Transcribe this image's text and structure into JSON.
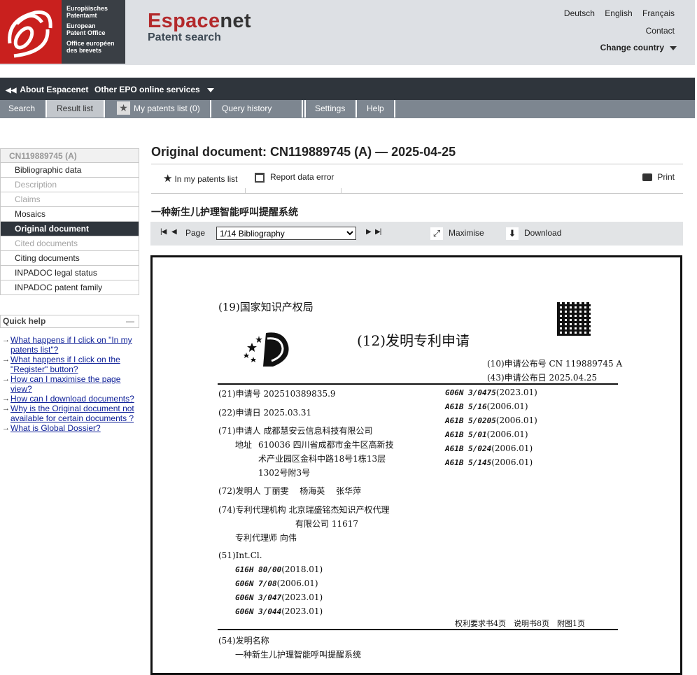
{
  "logo": {
    "lines": [
      "Europäisches",
      "Patentamt",
      "European",
      "Patent Office",
      "Office européen",
      "des brevets"
    ]
  },
  "brand": {
    "title_red": "Espace",
    "title_dark": "net",
    "subtitle": "Patent search"
  },
  "header_links": {
    "languages": [
      "Deutsch",
      "English",
      "Français"
    ],
    "contact": "Contact",
    "change_country": "Change country"
  },
  "topnav": {
    "about": "About Espacenet",
    "other": "Other EPO online services"
  },
  "tabs": [
    {
      "label": "Search"
    },
    {
      "label": "Result list"
    },
    {
      "label": "My patents list (0)"
    },
    {
      "label": "Query history"
    },
    {
      "label": ""
    },
    {
      "label": "Settings"
    },
    {
      "label": "Help"
    }
  ],
  "sidebar": {
    "items": [
      "CN119889745 (A)",
      "Bibliographic data",
      "Description",
      "Claims",
      "Mosaics",
      "Original document",
      "Cited documents",
      "Citing documents",
      "INPADOC legal status",
      "INPADOC patent family"
    ]
  },
  "quick_help": {
    "title": "Quick help",
    "links": [
      "What happens if I click on \"In my patents list\"?",
      "What happens if I click on the \"Register\" button?",
      "How can I maximise the page view?",
      "How can I download documents?",
      "Why is the Original document not available for certain documents ?",
      "What is Global Dossier?"
    ]
  },
  "main": {
    "title": "Original document: CN119889745 (A) — 2025-04-25",
    "actions": {
      "in_list": "In my patents list",
      "report": "Report data error",
      "print": "Print"
    },
    "doc_title_cn": "一种新生儿护理智能呼叫提醒系统",
    "viewer": {
      "page_label": "Page",
      "page_value": "1/14 Bibliography",
      "maximise": "Maximise",
      "download": "Download"
    }
  },
  "document": {
    "office": "(19)国家知识产权局",
    "kind": "(12)发明专利申请",
    "pub_no_label": "(10)申请公布号",
    "pub_no": "CN 119889745 A",
    "pub_date_label": "(43)申请公布日",
    "pub_date": "2025.04.25",
    "app_no_label": "(21)申请号",
    "app_no": "202510389835.9",
    "app_date_label": "(22)申请日",
    "app_date": "2025.03.31",
    "applicant_label": "(71)申请人",
    "applicant": "成都慧安云信息科技有限公司",
    "address_label": "地址",
    "address": [
      "610036 四川省成都市金牛区高新技",
      "术产业园区金科中路18号1栋13层",
      "1302号附3号"
    ],
    "inventor_label": "(72)发明人",
    "inventors": "丁丽雯　 杨海英　 张华萍",
    "agency_label": "(74)专利代理机构",
    "agency": [
      "北京瑞盛铭杰知识产权代理",
      "有限公司 11617"
    ],
    "agent_label": "专利代理师",
    "agent": "向伟",
    "intcl_label": "(51)Int.Cl.",
    "intcl": [
      {
        "code": "G16H 80/00",
        "ver": "(2018.01)"
      },
      {
        "code": "G06N 7/08",
        "ver": "(2006.01)"
      },
      {
        "code": "G06N 3/047",
        "ver": "(2023.01)"
      },
      {
        "code": "G06N 3/044",
        "ver": "(2023.01)"
      }
    ],
    "right_cls": [
      {
        "code": "G06N 3/0475",
        "ver": "(2023.01)"
      },
      {
        "code": "A61B 5/16",
        "ver": "(2006.01)"
      },
      {
        "code": "A61B 5/0205",
        "ver": "(2006.01)"
      },
      {
        "code": "A61B 5/01",
        "ver": "(2006.01)"
      },
      {
        "code": "A61B 5/024",
        "ver": "(2006.01)"
      },
      {
        "code": "A61B 5/145",
        "ver": "(2006.01)"
      }
    ],
    "page_counts": "权利要求书4页　说明书8页　附图1页",
    "title_label": "(54)发明名称",
    "title": "一种新生儿护理智能呼叫提醒系统"
  }
}
